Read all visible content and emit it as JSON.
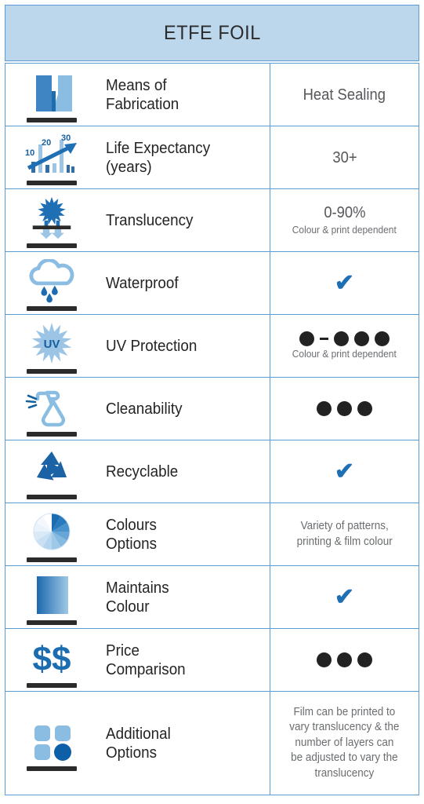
{
  "header": {
    "title": "ETFE FOIL"
  },
  "accent": {
    "border_blue": "#5b9bd5",
    "header_bg": "#bcd6ec",
    "icon_dark_blue": "#1f6fb5",
    "icon_light_blue": "#8bbde2",
    "dot_black": "#222222",
    "check_blue": "#1f6fb5"
  },
  "rows": [
    {
      "icon": "extrusion-die-icon",
      "label": "Means of\nFabrication",
      "value_type": "text",
      "value": "Heat Sealing",
      "subtext": ""
    },
    {
      "icon": "bar-chart-growth-icon",
      "label": "Life Expectancy\n(years)",
      "value_type": "text",
      "value": "30+",
      "subtext": "",
      "chart_labels": [
        "10",
        "20",
        "30"
      ]
    },
    {
      "icon": "sun-through-membrane-icon",
      "label": "Translucency",
      "value_type": "text",
      "value": "0-90%",
      "subtext": "Colour & print dependent"
    },
    {
      "icon": "rain-cloud-icon",
      "label": "Waterproof",
      "value_type": "check",
      "value": "✔",
      "subtext": ""
    },
    {
      "icon": "uv-burst-icon",
      "label": "UV Protection",
      "value_type": "dots-range",
      "value": "",
      "dots_low": 1,
      "dots_high": 3,
      "subtext": "Colour & print dependent"
    },
    {
      "icon": "spray-bottle-icon",
      "label": "Cleanability",
      "value_type": "dots",
      "value": "",
      "dots": 3,
      "subtext": ""
    },
    {
      "icon": "recycle-icon",
      "label": "Recyclable",
      "value_type": "check",
      "value": "✔",
      "subtext": ""
    },
    {
      "icon": "pie-chart-colours-icon",
      "label": "Colours\nOptions",
      "value_type": "paragraph",
      "value": "Variety of patterns,\nprinting & film colour",
      "subtext": ""
    },
    {
      "icon": "colour-gradient-swatch-icon",
      "label": "Maintains\nColour",
      "value_type": "check",
      "value": "✔",
      "subtext": ""
    },
    {
      "icon": "dollar-signs-icon",
      "label": "Price\nComparison",
      "value_type": "dots",
      "value": "",
      "dots": 3,
      "subtext": ""
    },
    {
      "icon": "options-grid-icon",
      "label": "Additional\nOptions",
      "value_type": "paragraph",
      "value": "Film can be printed to\nvary translucency & the\nnumber of layers can\nbe adjusted to vary the\ntranslucency",
      "subtext": ""
    }
  ]
}
